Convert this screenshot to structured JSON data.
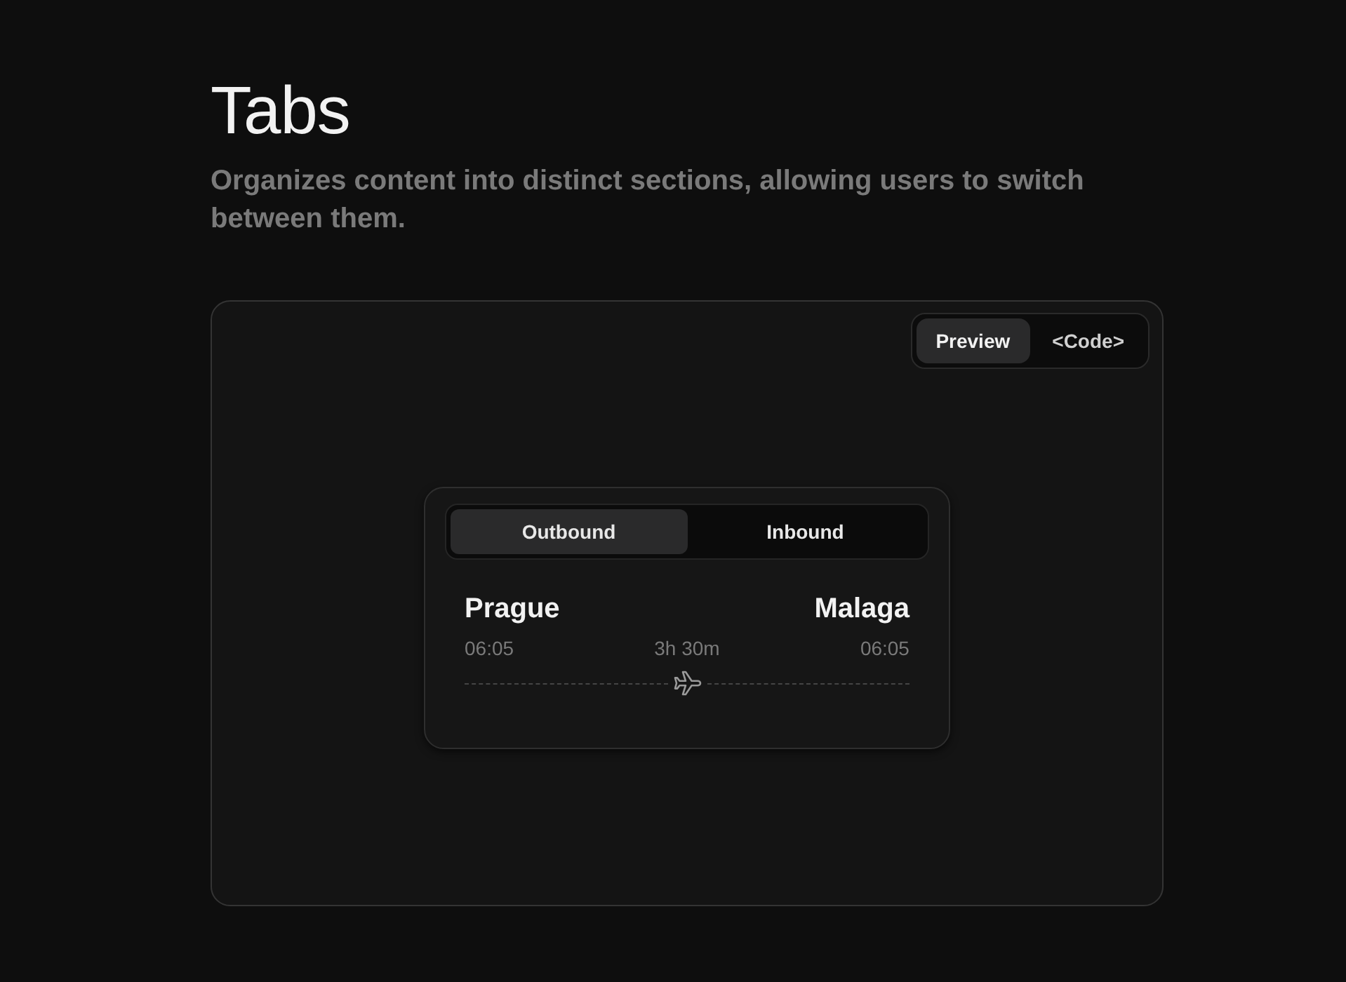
{
  "header": {
    "title": "Tabs",
    "description": "Organizes content into distinct sections, allowing users to switch between them."
  },
  "view_toggle": [
    {
      "label": "Preview",
      "selected": true
    },
    {
      "label": "<Code>",
      "selected": false
    }
  ],
  "tabs": [
    {
      "label": "Outbound",
      "selected": true
    },
    {
      "label": "Inbound",
      "selected": false
    }
  ],
  "flight": {
    "origin": "Prague",
    "destination": "Malaga",
    "departure": "06:05",
    "duration": "3h 30m",
    "arrival": "06:05"
  }
}
